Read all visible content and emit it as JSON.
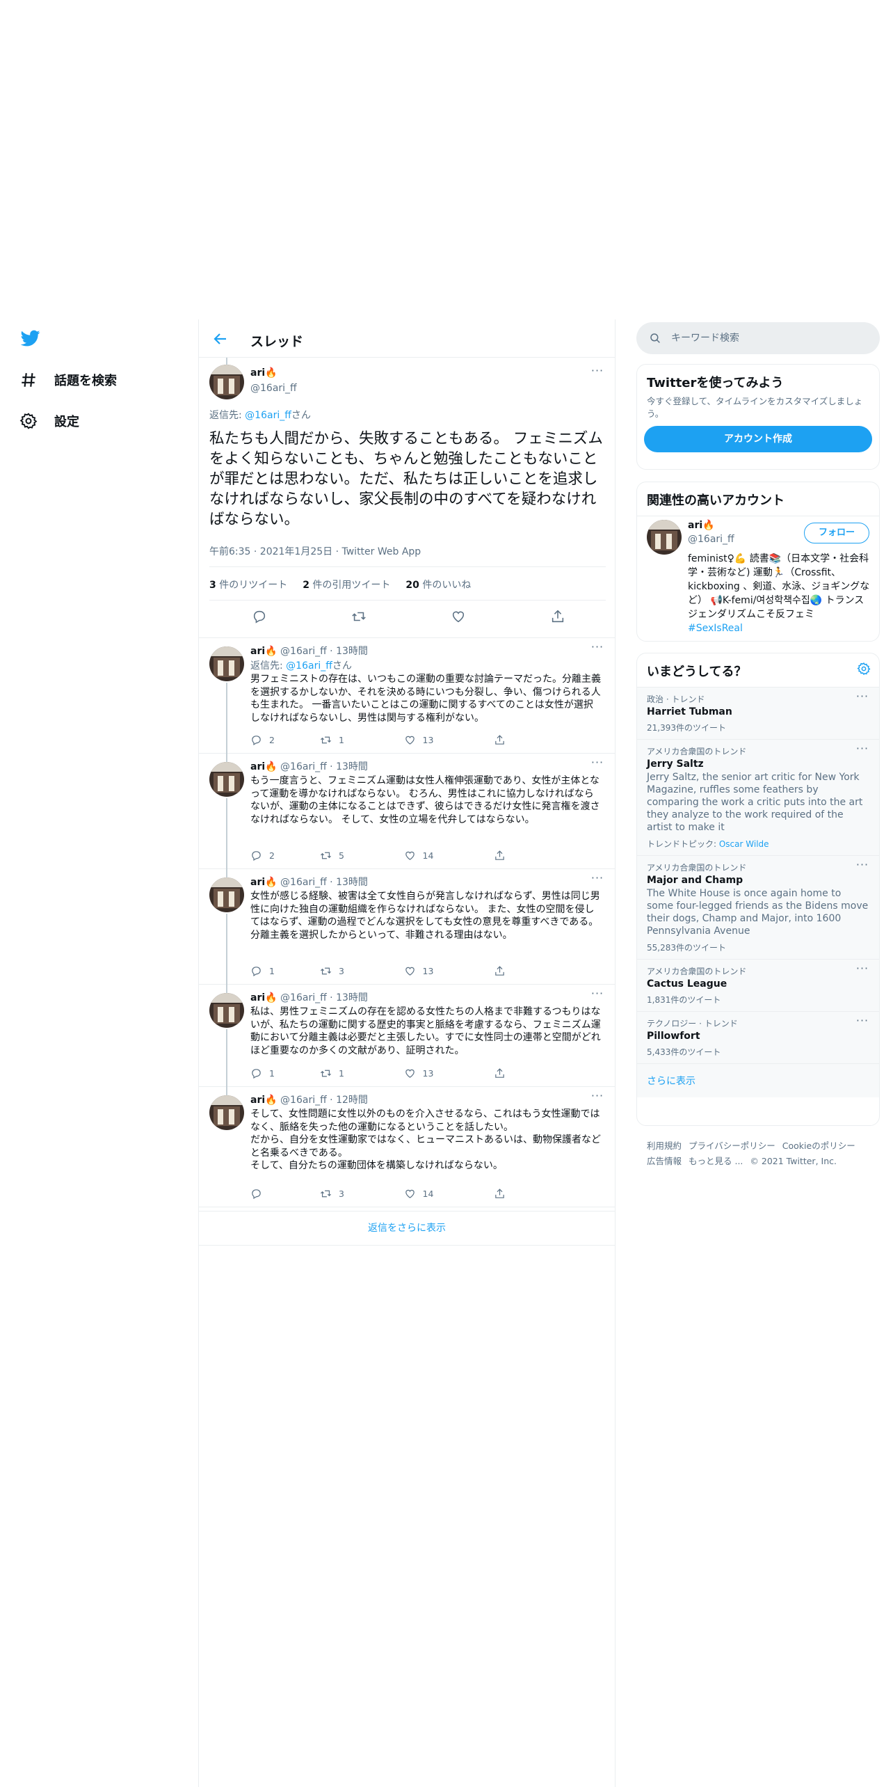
{
  "nav": {
    "explore": "話題を検索",
    "settings": "設定"
  },
  "header": {
    "title": "スレッド"
  },
  "main_tweet": {
    "name": "ari🔥",
    "handle": "@16ari_ff",
    "reply_prefix": "返信先: ",
    "reply_to": "@16ari_ff",
    "reply_suffix": "さん",
    "text": "私たちも人間だから、失敗することもある。 フェミニズムをよく知らないことも、ちゃんと勉強したこともないことが罪だとは思わない。ただ、私たちは正しいことを追求しなければならないし、家父長制の中のすべてを疑わなければならない。",
    "meta": "午前6:35 · 2021年1月25日 · Twitter Web App",
    "retweets_count": "3",
    "retweets_label": " 件のリツイート",
    "quotes_count": "2",
    "quotes_label": " 件の引用ツイート",
    "likes_count": "20",
    "likes_label": " 件のいいね"
  },
  "replies": [
    {
      "name": "ari🔥",
      "handle": "@16ari_ff · 13時間",
      "reply_prefix": "返信先: ",
      "reply_to": "@16ari_ff",
      "reply_suffix": "さん",
      "text": "男フェミニストの存在は、いつもこの運動の重要な討論テーマだった。分離主義を選択するかしないか、それを決める時にいつも分裂し、争い、傷つけられる人も生まれた。 一番言いたいことはこの運動に関するすべてのことは女性が選択しなければならないし、男性は関与する権利がない。",
      "replies": "2",
      "retweets": "1",
      "likes": "13"
    },
    {
      "name": "ari🔥",
      "handle": "@16ari_ff · 13時間",
      "text": "もう一度言うと、フェミニズム運動は女性人権伸張運動であり、女性が主体となって運動を導かなければならない。 むろん、男性はこれに協力しなければならないが、運動の主体になることはできず、彼らはできるだけ女性に発言権を渡さなければならない。 そして、女性の立場を代弁してはならない。",
      "replies": "2",
      "retweets": "5",
      "likes": "14"
    },
    {
      "name": "ari🔥",
      "handle": "@16ari_ff · 13時間",
      "text": "女性が感じる経験、被害は全て女性自らが発言しなければならず、男性は同じ男性に向けた独自の運動組織を作らなければならない。 また、女性の空間を侵してはならず、運動の過程でどんな選択をしても女性の意見を尊重すべきである。分離主義を選択したからといって、非難される理由はない。",
      "replies": "1",
      "retweets": "3",
      "likes": "13"
    },
    {
      "name": "ari🔥",
      "handle": "@16ari_ff · 13時間",
      "text": "私は、男性フェミニズムの存在を認める女性たちの人格まで非難するつもりはないが、私たちの運動に関する歴史的事実と脈絡を考慮するなら、フェミニズム運動において分離主義は必要だと主張したい。すでに女性同士の連帯と空間がどれほど重要なのか多くの文献があり、証明された。",
      "replies": "1",
      "retweets": "1",
      "likes": "13"
    },
    {
      "name": "ari🔥",
      "handle": "@16ari_ff · 12時間",
      "text": "そして、女性問題に女性以外のものを介入させるなら、これはもう女性運動ではなく、脈絡を失った他の運動になるということを話したい。\nだから、自分を女性運動家ではなく、ヒューマニストあるいは、動物保護者などと名乗るべきである。\nそして、自分たちの運動団体を構築しなければならない。",
      "replies": "",
      "retweets": "3",
      "likes": "14"
    }
  ],
  "more_replies": "返信をさらに表示",
  "search": {
    "placeholder": "キーワード検索"
  },
  "signup": {
    "title": "Twitterを使ってみよう",
    "subtitle": "今すぐ登録して、タイムラインをカスタマイズしましょう。",
    "button": "アカウント作成"
  },
  "relevant": {
    "title": "関連性の高いアカウント",
    "name": "ari🔥",
    "handle": "@16ari_ff",
    "follow": "フォロー",
    "bio": "feminist♀💪 読書📚（日本文学・社会科学・芸術など) 運動🏃（Crossfit、kickboxing 、剣道、水泳、ジョギングなど） 📢K-femi/여성학책수집🌏 トランスジェンダリズムこそ反フェミ ",
    "bio_tag": "#SexIsReal"
  },
  "trends": {
    "title": "いまどうしてる？",
    "items": [
      {
        "category": "政治 · トレンド",
        "title": "Harriet Tubman",
        "desc": "",
        "count": "21,393件のツイート",
        "topic_label": "",
        "topic": ""
      },
      {
        "category": "アメリカ合衆国のトレンド",
        "title": "Jerry Saltz",
        "desc": "Jerry Saltz, the senior art critic for New York Magazine, ruffles some feathers by comparing the work a critic puts into the art they analyze to the work required of the artist to make it",
        "count": "",
        "topic_label": "トレンドトピック: ",
        "topic": "Oscar Wilde"
      },
      {
        "category": "アメリカ合衆国のトレンド",
        "title": "Major and Champ",
        "desc": "The White House is once again home to some four-legged friends as the Bidens move their dogs, Champ and Major, into 1600 Pennsylvania Avenue",
        "count": "55,283件のツイート",
        "topic_label": "",
        "topic": ""
      },
      {
        "category": "アメリカ合衆国のトレンド",
        "title": "Cactus League",
        "desc": "",
        "count": "1,831件のツイート",
        "topic_label": "",
        "topic": ""
      },
      {
        "category": "テクノロジー · トレンド",
        "title": "Pillowfort",
        "desc": "",
        "count": "5,433件のツイート",
        "topic_label": "",
        "topic": ""
      }
    ],
    "show_more": "さらに表示"
  },
  "footer": {
    "terms": "利用規約",
    "privacy": "プライバシーポリシー",
    "cookie": "Cookieのポリシー",
    "ads": "広告情報",
    "more": "もっと見る ...",
    "copyright": "© 2021 Twitter, Inc."
  },
  "colors": {
    "accent": "#1da1f2",
    "muted": "#5b7083",
    "border": "#ebeef0"
  }
}
